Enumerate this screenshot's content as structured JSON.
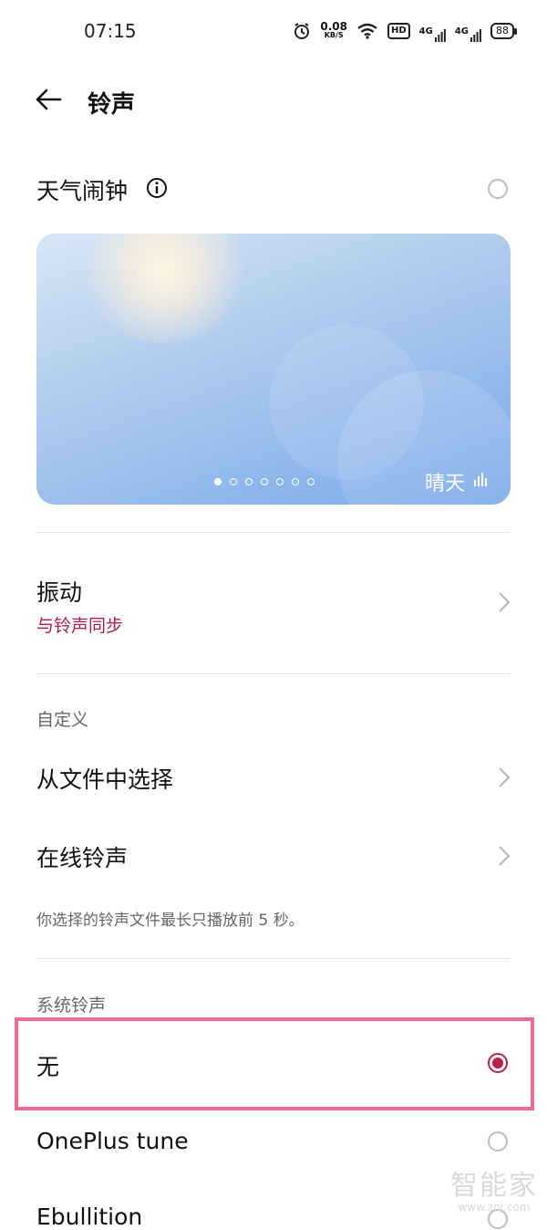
{
  "status": {
    "time": "07:15",
    "speed": "0.08",
    "speed_unit": "KB/S",
    "hd": "HD",
    "net1": "4G",
    "net2": "4G",
    "battery": "88"
  },
  "header": {
    "title": "铃声"
  },
  "weather_alarm": {
    "label": "天气闹钟",
    "weather": "晴天",
    "page_count": 7,
    "active_page": 1
  },
  "vibration": {
    "label": "振动",
    "value": "与铃声同步"
  },
  "custom": {
    "section": "自定义",
    "from_file": "从文件中选择",
    "online": "在线铃声",
    "note": "你选择的铃声文件最长只播放前 5 秒。"
  },
  "system": {
    "section": "系统铃声",
    "items": [
      {
        "label": "无",
        "selected": true
      },
      {
        "label": "OnePlus tune",
        "selected": false
      },
      {
        "label": "Ebullition",
        "selected": false
      }
    ]
  },
  "watermark": {
    "cn": "智能家",
    "url": "www.znj.com"
  },
  "colors": {
    "accent": "#c01f48",
    "highlight": "#f06a92"
  }
}
